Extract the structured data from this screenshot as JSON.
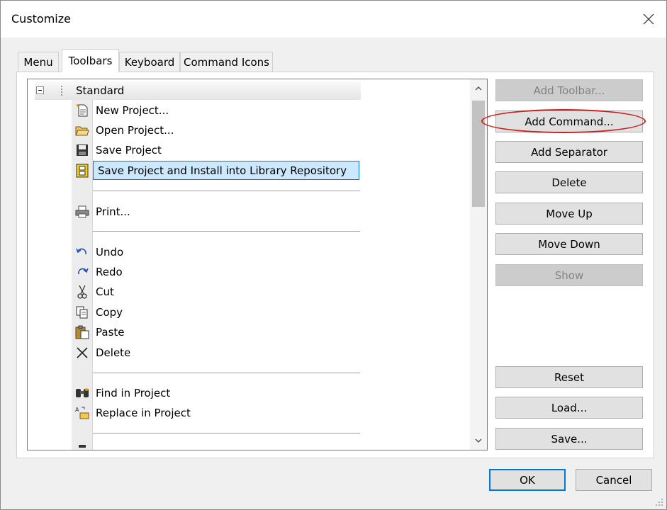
{
  "window": {
    "title": "Customize"
  },
  "tabs": [
    {
      "label": "Menu",
      "active": false
    },
    {
      "label": "Toolbars",
      "active": true
    },
    {
      "label": "Keyboard",
      "active": false
    },
    {
      "label": "Command Icons",
      "active": false
    }
  ],
  "toolbar_tree": {
    "header": "Standard",
    "items": [
      {
        "label": "New Project...",
        "icon": "new-project-icon"
      },
      {
        "label": "Open Project...",
        "icon": "open-folder-icon"
      },
      {
        "label": "Save Project",
        "icon": "save-disk-icon"
      },
      {
        "label": "Save Project and Install into Library Repository",
        "icon": "library-install-icon",
        "selected": true
      },
      {
        "label": "Print...",
        "icon": "printer-icon"
      },
      {
        "label": "Undo",
        "icon": "undo-icon"
      },
      {
        "label": "Redo",
        "icon": "redo-icon"
      },
      {
        "label": "Cut",
        "icon": "scissors-icon"
      },
      {
        "label": "Copy",
        "icon": "copy-icon"
      },
      {
        "label": "Paste",
        "icon": "paste-icon"
      },
      {
        "label": "Delete",
        "icon": "delete-x-icon"
      },
      {
        "label": "Find in Project",
        "icon": "binoculars-icon"
      },
      {
        "label": "Replace in Project",
        "icon": "replace-icon"
      }
    ]
  },
  "side_buttons": [
    {
      "label": "Add Toolbar...",
      "enabled": false
    },
    {
      "label": "Add Command...",
      "enabled": true,
      "highlighted": true
    },
    {
      "label": "Add Separator",
      "enabled": true
    },
    {
      "label": "Delete",
      "enabled": true
    },
    {
      "label": "Move Up",
      "enabled": true
    },
    {
      "label": "Move Down",
      "enabled": true
    },
    {
      "label": "Show",
      "enabled": false
    },
    {
      "label": "Reset",
      "enabled": true
    },
    {
      "label": "Load...",
      "enabled": true
    },
    {
      "label": "Save...",
      "enabled": true
    }
  ],
  "footer": {
    "ok_label": "OK",
    "cancel_label": "Cancel"
  },
  "colors": {
    "selection_fill": "#cce8ff",
    "selection_border": "#0078d7",
    "highlight_ellipse": "#cc1f1f"
  }
}
